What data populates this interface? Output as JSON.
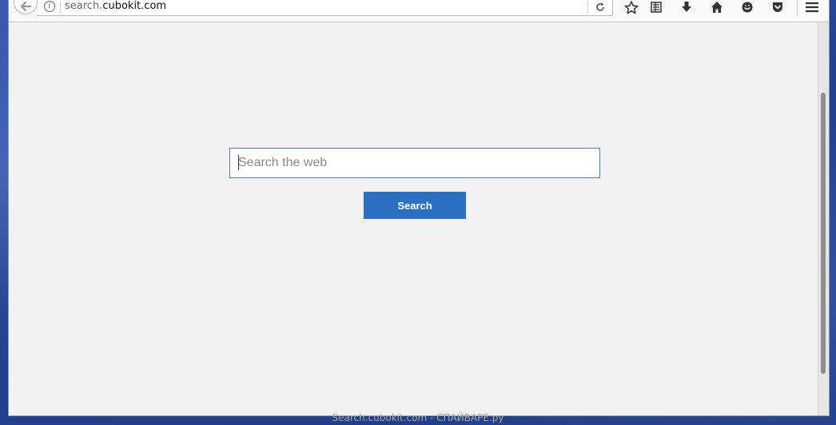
{
  "browser": {
    "url_prefix": "search.",
    "url_domain": "cubokit.com"
  },
  "search": {
    "placeholder": "Search the web",
    "button_label": "Search"
  },
  "watermark": {
    "text": "Search.cubokit.com - СПАЙВАРЕ.ру"
  },
  "colors": {
    "accent": "#2b70c2",
    "input_border": "#4a84c6",
    "page_background": "#f2f2f2"
  },
  "icons": {
    "back": "back-arrow-icon",
    "info": "info-icon",
    "reload": "reload-icon",
    "bookmark": "star-icon",
    "reader": "reading-list-icon",
    "downloads": "download-icon",
    "home": "home-icon",
    "hello": "chat-icon",
    "pocket": "pocket-icon",
    "menu": "hamburger-menu-icon"
  }
}
